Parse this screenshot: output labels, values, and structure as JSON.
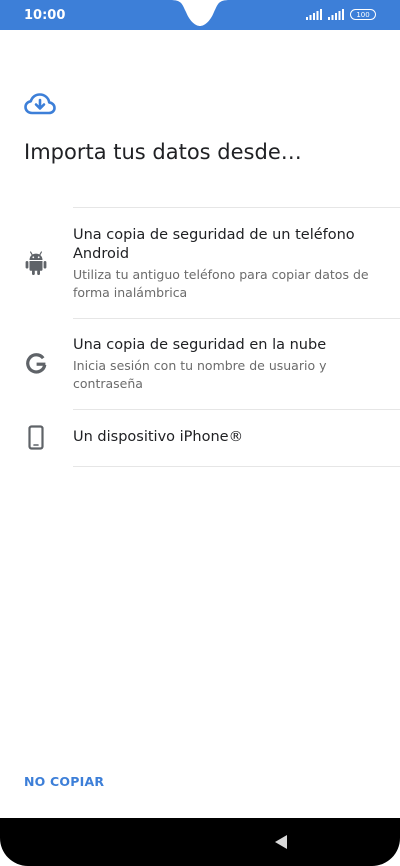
{
  "status_bar": {
    "time": "10:00",
    "battery": "100",
    "signal_icon": "signal-icon",
    "battery_icon": "battery-icon"
  },
  "header": {
    "icon": "cloud-download-icon",
    "title": "Importa tus datos desde…"
  },
  "options": [
    {
      "icon": "android-icon",
      "title": "Una copia de seguridad de un teléfono Android",
      "subtitle": "Utiliza tu antiguo teléfono para copiar datos de forma inalámbrica"
    },
    {
      "icon": "google-icon",
      "title": "Una copia de seguridad en la nube",
      "subtitle": "Inicia sesión con tu nombre de usuario y contraseña"
    },
    {
      "icon": "phone-icon",
      "title": "Un dispositivo iPhone®",
      "subtitle": ""
    }
  ],
  "footer": {
    "no_copy_label": "NO COPIAR"
  },
  "navigation": {
    "back_icon": "back-icon"
  },
  "colors": {
    "accent": "#3d7fd8",
    "text_primary": "#202124",
    "text_secondary": "#6b6b6b",
    "icon": "#5f6368",
    "divider": "#e6e6e6"
  }
}
